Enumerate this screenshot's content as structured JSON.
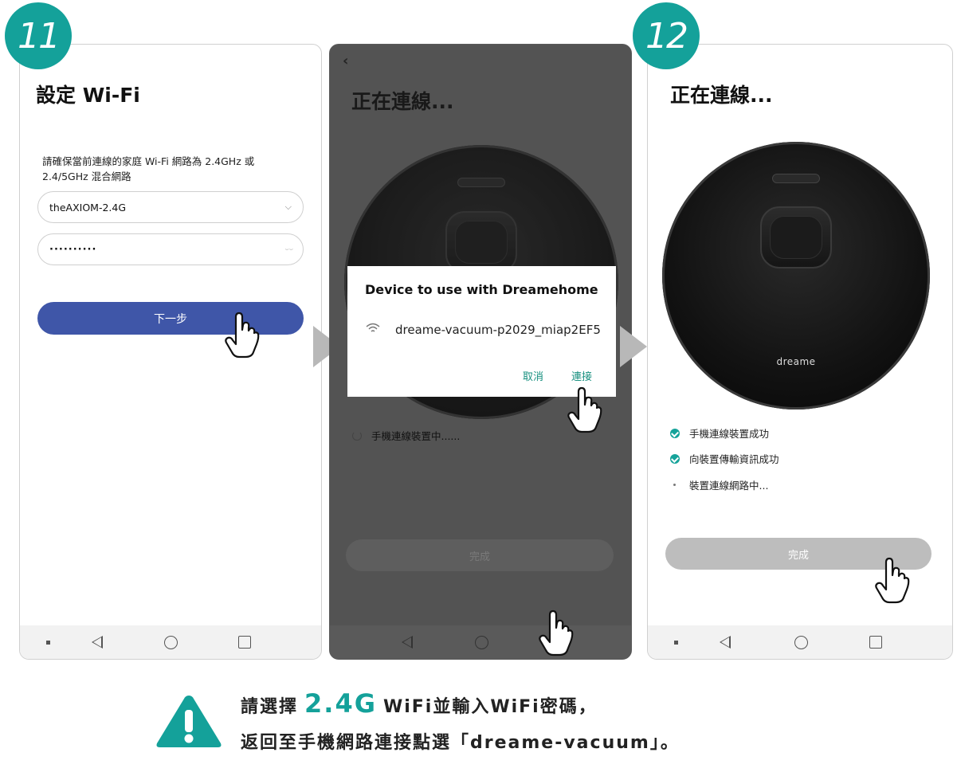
{
  "badges": {
    "step1": "11",
    "step2": "12"
  },
  "screen1": {
    "title": "設定 Wi-Fi",
    "description": "請確保當前連線的家庭 Wi-Fi 網路為 2.4GHz 或 2.4/5GHz 混合網路",
    "ssid_value": "theAXIOM-2.4G",
    "password_value": "··········",
    "next_button": "下一步"
  },
  "screen2": {
    "title": "正在連線...",
    "dialog": {
      "title": "Device to use with Dreamehome",
      "device": "dreame-vacuum-p2029_miap2EF5",
      "cancel": "取消",
      "connect": "連接"
    },
    "status": "手機連線裝置中......",
    "done_button": "完成"
  },
  "screen3": {
    "title": "正在連線...",
    "robot_brand": "dreame",
    "status": [
      "手機連線裝置成功",
      "向裝置傳輸資訊成功",
      "裝置連線網路中..."
    ],
    "done_button": "完成"
  },
  "note": {
    "line1_prefix": "請選擇",
    "line1_highlight": "2.4G",
    "line1_suffix": "WiFi並輸入WiFi密碼，",
    "line2": "返回至手機網路連接點選「dreame-vacuum」。"
  },
  "colors": {
    "accent": "#14a19a",
    "primary_button": "#3f56a8",
    "dialog_action": "#17907f"
  }
}
